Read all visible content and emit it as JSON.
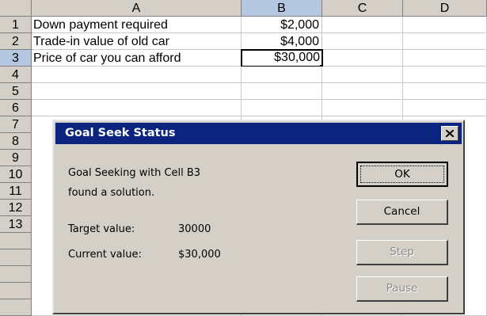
{
  "sheet": {
    "columns": [
      "A",
      "B",
      "C",
      "D"
    ],
    "rows": [
      "1",
      "2",
      "3",
      "4",
      "5",
      "6",
      "7",
      "8",
      "9",
      "10",
      "11",
      "12",
      "13"
    ],
    "selected_column": "B",
    "selected_row": "3",
    "cells": {
      "A1": "Down payment required",
      "B1": "$2,000",
      "A2": "Trade-in value of old car",
      "B2": "$4,000",
      "A3": "Price of car you can afford",
      "B3": "$30,000"
    },
    "active_cell": "B3"
  },
  "dialog": {
    "title": "Goal Seek Status",
    "message_line1": "Goal Seeking with Cell B3",
    "message_line2": "found a solution.",
    "target_label": "Target value:",
    "target_value": "30000",
    "current_label": "Current value:",
    "current_value": "$30,000",
    "buttons": {
      "ok": "OK",
      "cancel": "Cancel",
      "step": "Step",
      "pause": "Pause"
    }
  },
  "colors": {
    "titlebar": "#0a2480",
    "face": "#d4d0c8",
    "header_selected": "#b5c7e0",
    "gridline": "#c8c8c8"
  }
}
